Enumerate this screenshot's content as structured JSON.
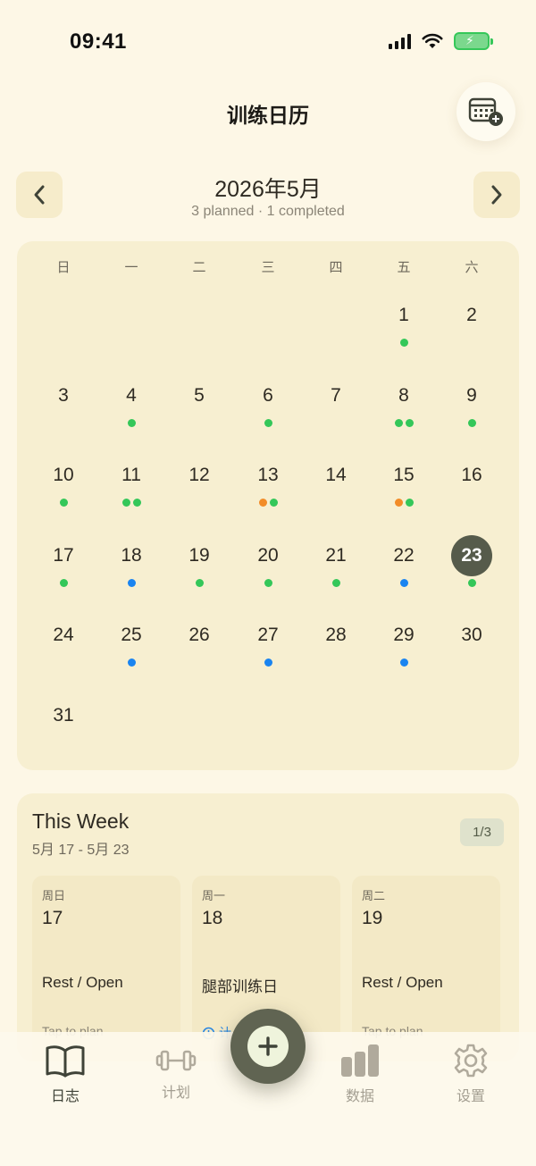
{
  "status_bar": {
    "time": "09:41"
  },
  "header": {
    "title": "训练日历"
  },
  "month_nav": {
    "title": "2026年5月",
    "summary": "3 planned · 1 completed"
  },
  "calendar": {
    "weekdays": [
      "日",
      "一",
      "二",
      "三",
      "四",
      "五",
      "六"
    ],
    "selected_day": "23",
    "colors": {
      "green": "#34c759",
      "orange": "#f28c28",
      "blue": "#1a84f0",
      "selected_bg": "#565b4b"
    },
    "days": [
      {
        "day": "1",
        "col": 5,
        "row": 0,
        "dots": [
          "green"
        ]
      },
      {
        "day": "2",
        "col": 6,
        "row": 0,
        "dots": []
      },
      {
        "day": "3",
        "col": 0,
        "row": 1,
        "dots": []
      },
      {
        "day": "4",
        "col": 1,
        "row": 1,
        "dots": [
          "green"
        ]
      },
      {
        "day": "5",
        "col": 2,
        "row": 1,
        "dots": []
      },
      {
        "day": "6",
        "col": 3,
        "row": 1,
        "dots": [
          "green"
        ]
      },
      {
        "day": "7",
        "col": 4,
        "row": 1,
        "dots": []
      },
      {
        "day": "8",
        "col": 5,
        "row": 1,
        "dots": [
          "green",
          "green"
        ]
      },
      {
        "day": "9",
        "col": 6,
        "row": 1,
        "dots": [
          "green"
        ]
      },
      {
        "day": "10",
        "col": 0,
        "row": 2,
        "dots": [
          "green"
        ]
      },
      {
        "day": "11",
        "col": 1,
        "row": 2,
        "dots": [
          "green",
          "green"
        ]
      },
      {
        "day": "12",
        "col": 2,
        "row": 2,
        "dots": []
      },
      {
        "day": "13",
        "col": 3,
        "row": 2,
        "dots": [
          "orange",
          "green"
        ]
      },
      {
        "day": "14",
        "col": 4,
        "row": 2,
        "dots": []
      },
      {
        "day": "15",
        "col": 5,
        "row": 2,
        "dots": [
          "orange",
          "green"
        ]
      },
      {
        "day": "16",
        "col": 6,
        "row": 2,
        "dots": []
      },
      {
        "day": "17",
        "col": 0,
        "row": 3,
        "dots": [
          "green"
        ]
      },
      {
        "day": "18",
        "col": 1,
        "row": 3,
        "dots": [
          "blue"
        ]
      },
      {
        "day": "19",
        "col": 2,
        "row": 3,
        "dots": [
          "green"
        ]
      },
      {
        "day": "20",
        "col": 3,
        "row": 3,
        "dots": [
          "green"
        ]
      },
      {
        "day": "21",
        "col": 4,
        "row": 3,
        "dots": [
          "green"
        ]
      },
      {
        "day": "22",
        "col": 5,
        "row": 3,
        "dots": [
          "blue"
        ]
      },
      {
        "day": "23",
        "col": 6,
        "row": 3,
        "dots": [
          "green"
        ]
      },
      {
        "day": "24",
        "col": 0,
        "row": 4,
        "dots": []
      },
      {
        "day": "25",
        "col": 1,
        "row": 4,
        "dots": [
          "blue"
        ]
      },
      {
        "day": "26",
        "col": 2,
        "row": 4,
        "dots": []
      },
      {
        "day": "27",
        "col": 3,
        "row": 4,
        "dots": [
          "blue"
        ]
      },
      {
        "day": "28",
        "col": 4,
        "row": 4,
        "dots": []
      },
      {
        "day": "29",
        "col": 5,
        "row": 4,
        "dots": [
          "blue"
        ]
      },
      {
        "day": "30",
        "col": 6,
        "row": 4,
        "dots": []
      },
      {
        "day": "31",
        "col": 0,
        "row": 5,
        "dots": []
      }
    ]
  },
  "this_week": {
    "title": "This Week",
    "range": "5月 17 - 5月 23",
    "page_badge": "1/3",
    "cards": [
      {
        "weekday": "周日",
        "date": "17",
        "plan": "Rest / Open",
        "hint": "Tap to plan"
      },
      {
        "weekday": "周一",
        "date": "18",
        "plan": "腿部训练日",
        "status": "计"
      },
      {
        "weekday": "周二",
        "date": "19",
        "plan": "Rest / Open",
        "hint": "Tap to plan"
      }
    ]
  },
  "tab_bar": {
    "items": [
      {
        "label": "日志",
        "icon": "book-icon",
        "active": true
      },
      {
        "label": "计划",
        "icon": "dumbbell-icon",
        "active": false
      },
      {
        "label": "数据",
        "icon": "bar-chart-icon",
        "active": false
      },
      {
        "label": "设置",
        "icon": "gear-icon",
        "active": false
      }
    ],
    "fab_icon": "plus-icon"
  }
}
